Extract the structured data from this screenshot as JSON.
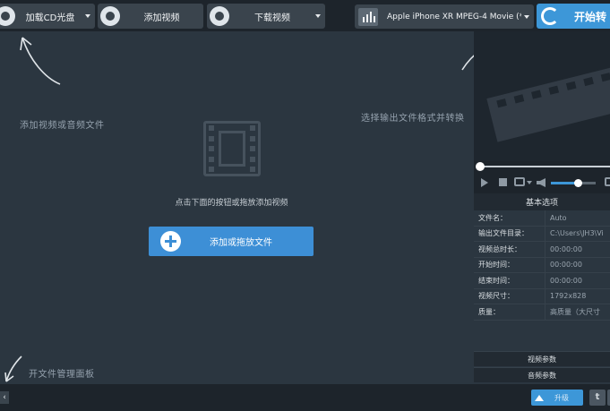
{
  "toolbar": {
    "load_cd_label": "加载CD光盘",
    "add_video_label": "添加视频",
    "download_video_label": "下载视频",
    "output_format_label": "Apple iPhone XR MPEG-4 Movie (*.m...",
    "convert_label": "开始转"
  },
  "main": {
    "drop_hint": "点击下面的按钮或拖放添加视频",
    "add_file_label": "添加或拖放文件",
    "hint_add_files": "添加视频或音频文件",
    "hint_select_format": "选择输出文件格式并转换",
    "hint_file_manager": "开文件管理面板"
  },
  "panel": {
    "basic_options": "基本选项",
    "properties": [
      {
        "key": "文件名：",
        "value": "Auto"
      },
      {
        "key": "输出文件目录：",
        "value": "C:\\Users\\JH3\\Vi"
      },
      {
        "key": "视频总时长：",
        "value": "00:00:00"
      },
      {
        "key": "开始时间：",
        "value": "00:00:00"
      },
      {
        "key": "结束时间：",
        "value": "00:00:00"
      },
      {
        "key": "视频尺寸：",
        "value": "1792x828"
      },
      {
        "key": "质量：",
        "value": "高质量（大尺寸"
      }
    ],
    "video_params": "视频参数",
    "audio_params": "音频参数",
    "volume_level": 0.6
  },
  "bottom": {
    "collapse_glyph": "‹",
    "upgrade_label": "升级",
    "twitter_glyph": "t",
    "social2_glyph": "V"
  },
  "colors": {
    "accent": "#3d97d8",
    "background": "#2b3640",
    "toolbar": "#1d242b"
  },
  "icons": {
    "load_cd": "disc-plus-icon",
    "add_video": "film-plus-icon",
    "download_video": "globe-download-icon",
    "format": "bar-chart-icon",
    "convert": "refresh-icon"
  }
}
